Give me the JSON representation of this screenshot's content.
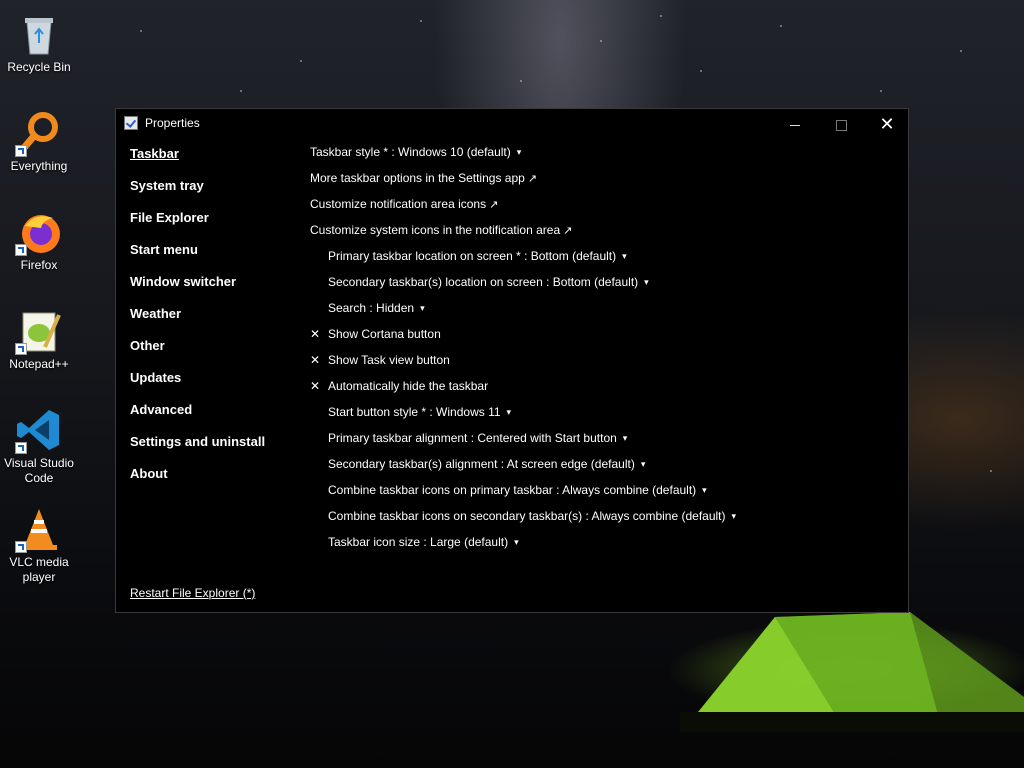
{
  "desktop": {
    "icons": [
      {
        "label": "Recycle Bin",
        "icon": "recycle-bin-icon"
      },
      {
        "label": "Everything",
        "icon": "everything-search-icon"
      },
      {
        "label": "Firefox",
        "icon": "firefox-icon"
      },
      {
        "label": "Notepad++",
        "icon": "notepad-plus-plus-icon"
      },
      {
        "label": "Visual Studio Code",
        "icon": "vscode-icon"
      },
      {
        "label": "VLC media player",
        "icon": "vlc-icon"
      }
    ]
  },
  "window": {
    "title": "Properties",
    "controls": {
      "minimize": "minimize-icon",
      "maximize": "maximize-icon",
      "close": "close-icon",
      "close_glyph": "✕"
    }
  },
  "sidebar": {
    "items": [
      {
        "label": "Taskbar",
        "active": true
      },
      {
        "label": "System tray"
      },
      {
        "label": "File Explorer"
      },
      {
        "label": "Start menu"
      },
      {
        "label": "Window switcher"
      },
      {
        "label": "Weather"
      },
      {
        "label": "Other"
      },
      {
        "label": "Updates"
      },
      {
        "label": "Advanced"
      },
      {
        "label": "Settings and uninstall"
      },
      {
        "label": "About"
      }
    ],
    "restart_link": "Restart File Explorer (*)"
  },
  "settings": {
    "caret": "▾",
    "external": "↗",
    "check": "✕",
    "rows": [
      {
        "text": "Taskbar style * : Windows 10 (default)",
        "type": "dropdown"
      },
      {
        "text": "More taskbar options in the Settings app",
        "type": "link"
      },
      {
        "text": "Customize notification area icons",
        "type": "link"
      },
      {
        "text": "Customize system icons in the notification area",
        "type": "link"
      },
      {
        "text": "Primary taskbar location on screen * : Bottom (default)",
        "type": "dropdown"
      },
      {
        "text": "Secondary taskbar(s) location on screen : Bottom (default)",
        "type": "dropdown"
      },
      {
        "text": "Search : Hidden",
        "type": "dropdown"
      },
      {
        "text": "Show Cortana button",
        "type": "checkbox"
      },
      {
        "text": "Show Task view button",
        "type": "checkbox"
      },
      {
        "text": "Automatically hide the taskbar",
        "type": "checkbox"
      },
      {
        "text": "Start button style * : Windows 11",
        "type": "dropdown"
      },
      {
        "text": "Primary taskbar alignment : Centered with Start button",
        "type": "dropdown"
      },
      {
        "text": "Secondary taskbar(s) alignment : At screen edge (default)",
        "type": "dropdown"
      },
      {
        "text": "Combine taskbar icons on primary taskbar : Always combine (default)",
        "type": "dropdown"
      },
      {
        "text": "Combine taskbar icons on secondary taskbar(s) : Always combine (default)",
        "type": "dropdown"
      },
      {
        "text": "Taskbar icon size : Large (default)",
        "type": "dropdown"
      }
    ]
  }
}
